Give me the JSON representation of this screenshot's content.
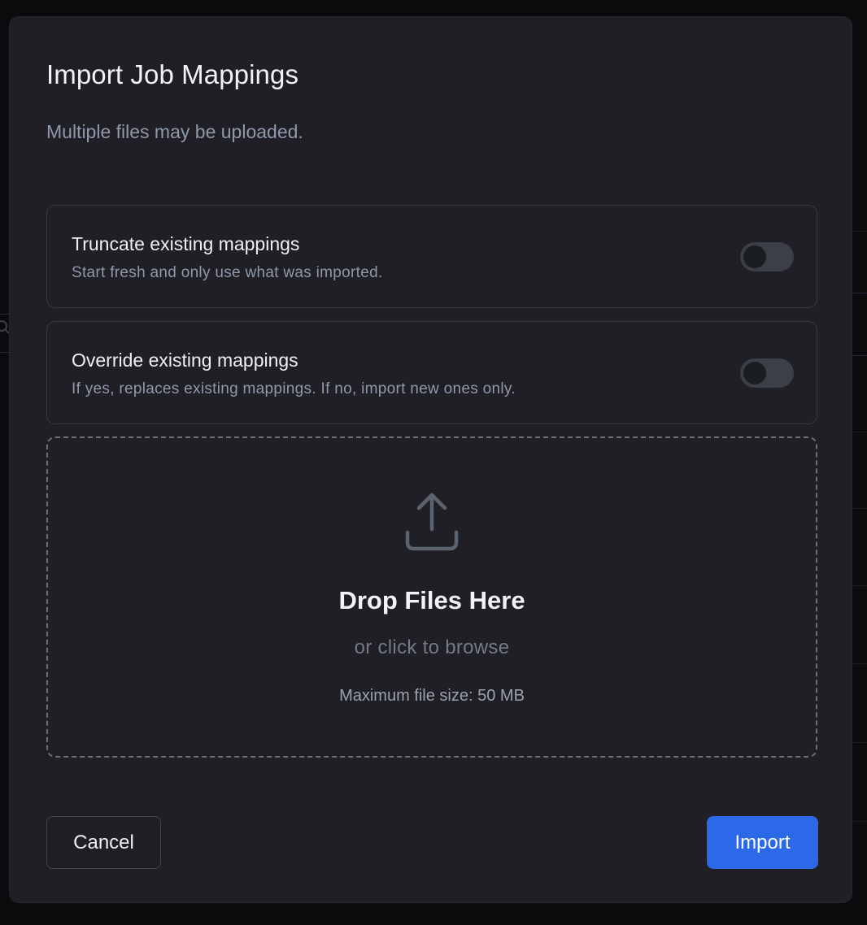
{
  "modal": {
    "title": "Import Job Mappings",
    "subtitle": "Multiple files may be uploaded."
  },
  "options": {
    "truncate": {
      "title": "Truncate existing mappings",
      "description": "Start fresh and only use what was imported.",
      "enabled": false
    },
    "override": {
      "title": "Override existing mappings",
      "description": "If yes, replaces existing mappings. If no, import new ones only.",
      "enabled": false
    }
  },
  "dropzone": {
    "icon": "upload-icon",
    "title": "Drop Files Here",
    "subtitle": "or click to browse",
    "max_size": "Maximum file size: 50 MB"
  },
  "footer": {
    "cancel_label": "Cancel",
    "import_label": "Import"
  },
  "colors": {
    "modal_bg": "#1f1f25",
    "accent": "#2c69e9",
    "toggle_off": "#3a3f48"
  }
}
